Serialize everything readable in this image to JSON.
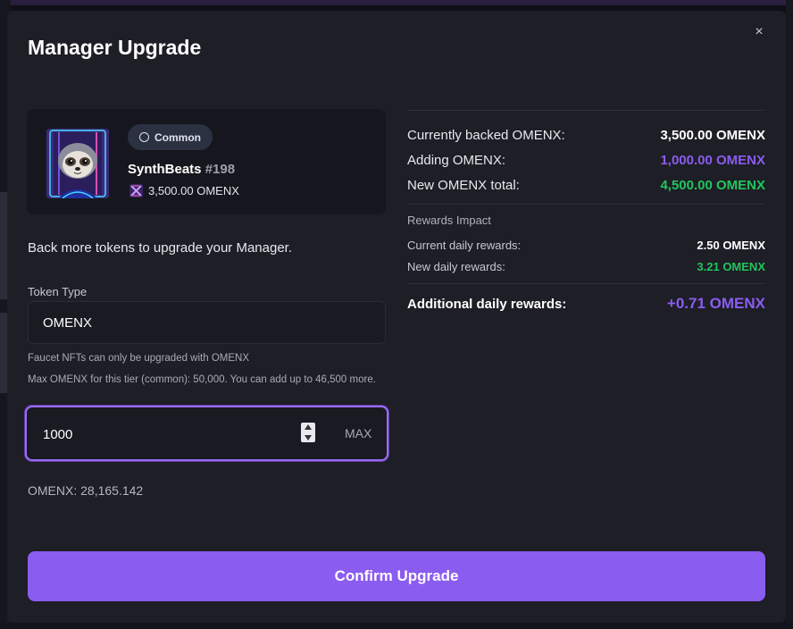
{
  "modal": {
    "title": "Manager Upgrade",
    "close_symbol": "×"
  },
  "nft": {
    "rarity": "Common",
    "name": "SynthBeats",
    "number": "#198",
    "backed": "3,500.00 OMENX",
    "image_icon": "sloth-portrait-icon"
  },
  "form": {
    "helper_text": "Back more tokens to upgrade your Manager.",
    "token_type_label": "Token Type",
    "token_type_value": "OMENX",
    "note_1": "Faucet NFTs can only be upgraded with OMENX",
    "note_2": "Max OMENX for this tier (common): 50,000. You can add up to 46,500 more.",
    "amount_value": "1000",
    "max_label": "MAX",
    "balance": "OMENX: 28,165.142",
    "confirm_label": "Confirm Upgrade"
  },
  "summary": {
    "currently_backed_label": "Currently backed OMENX:",
    "currently_backed_value": "3,500.00 OMENX",
    "adding_label": "Adding OMENX:",
    "adding_value": "1,000.00 OMENX",
    "new_total_label": "New OMENX total:",
    "new_total_value": "4,500.00 OMENX",
    "rewards_section_label": "Rewards Impact",
    "current_daily_label": "Current daily rewards:",
    "current_daily_value": "2.50 OMENX",
    "new_daily_label": "New daily rewards:",
    "new_daily_value": "3.21 OMENX",
    "additional_label": "Additional daily rewards:",
    "additional_value": "+0.71 OMENX"
  },
  "colors": {
    "accent": "#8b5cf0",
    "positive": "#22c55e",
    "modal_bg": "#1d1e26"
  }
}
